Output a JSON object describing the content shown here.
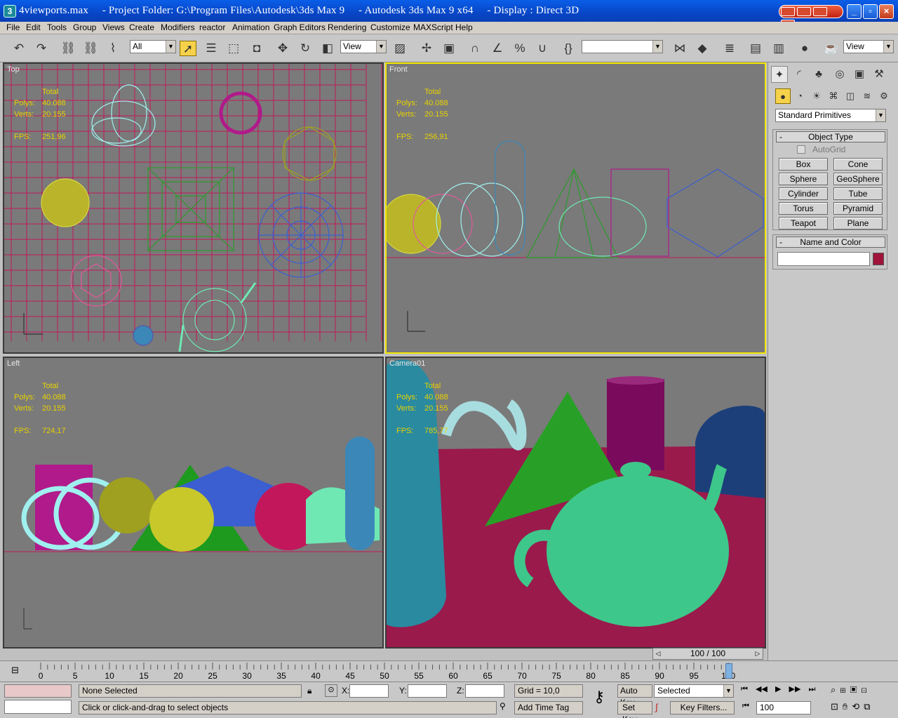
{
  "title_bar": {
    "text": "4viewports.max     - Project Folder: G:\\Program Files\\Autodesk\\3ds Max 9     - Autodesk 3ds Max 9 x64     - Display : Direct 3D",
    "app_icon": "3ds-max-icon"
  },
  "menu": [
    "File",
    "Edit",
    "Tools",
    "Group",
    "Views",
    "Create",
    "Modifiers",
    "reactor",
    "Animation",
    "Graph Editors",
    "Rendering",
    "Customize",
    "MAXScript",
    "Help"
  ],
  "toolbar": {
    "selection_filter": "All",
    "ref_coord_left": "View",
    "named_selection": "",
    "ref_coord_right": "View"
  },
  "viewports": {
    "top": {
      "label": "Top",
      "total": "Total",
      "polys_label": "Polys:",
      "polys": "40.088",
      "verts_label": "Verts:",
      "verts": "20.155",
      "fps_label": "FPS:",
      "fps": "251,96"
    },
    "front": {
      "label": "Front",
      "total": "Total",
      "polys_label": "Polys:",
      "polys": "40.088",
      "verts_label": "Verts:",
      "verts": "20.155",
      "fps_label": "FPS:",
      "fps": "256,91"
    },
    "left": {
      "label": "Left",
      "total": "Total",
      "polys_label": "Polys:",
      "polys": "40.088",
      "verts_label": "Verts:",
      "verts": "20.155",
      "fps_label": "FPS:",
      "fps": "724,17"
    },
    "camera": {
      "label": "Camera01",
      "total": "Total",
      "polys_label": "Polys:",
      "polys": "40.088",
      "verts_label": "Verts:",
      "verts": "20.155",
      "fps_label": "FPS:",
      "fps": "785,77"
    }
  },
  "command_panel": {
    "category": "Standard Primitives",
    "object_type_title": "Object Type",
    "autogrid": "AutoGrid",
    "buttons": [
      "Box",
      "Cone",
      "Sphere",
      "GeoSphere",
      "Cylinder",
      "Tube",
      "Torus",
      "Pyramid",
      "Teapot",
      "Plane"
    ],
    "name_color_title": "Name and Color",
    "name_value": "",
    "object_color": "#a0143c"
  },
  "timeline": {
    "slider": "100 / 100",
    "ticks": [
      "0",
      "5",
      "10",
      "15",
      "20",
      "25",
      "30",
      "35",
      "40",
      "45",
      "50",
      "55",
      "60",
      "65",
      "70",
      "75",
      "80",
      "85",
      "90",
      "95",
      "100"
    ]
  },
  "status": {
    "selection": "None Selected",
    "prompt": "Click or click-and-drag to select objects",
    "x_label": "X:",
    "y_label": "Y:",
    "z_label": "Z:",
    "x": "",
    "y": "",
    "z": "",
    "grid": "Grid = 10,0",
    "add_time_tag": "Add Time Tag",
    "auto_key": "Auto Key",
    "set_key": "Set Key",
    "key_mode": "Selected",
    "key_filters": "Key Filters...",
    "frame": "100"
  },
  "colors": {
    "viewport_bg": "#7a7a7a",
    "active_border": "#f2e600",
    "grid_line": "#c2185b",
    "stats_text": "#e8d200"
  }
}
